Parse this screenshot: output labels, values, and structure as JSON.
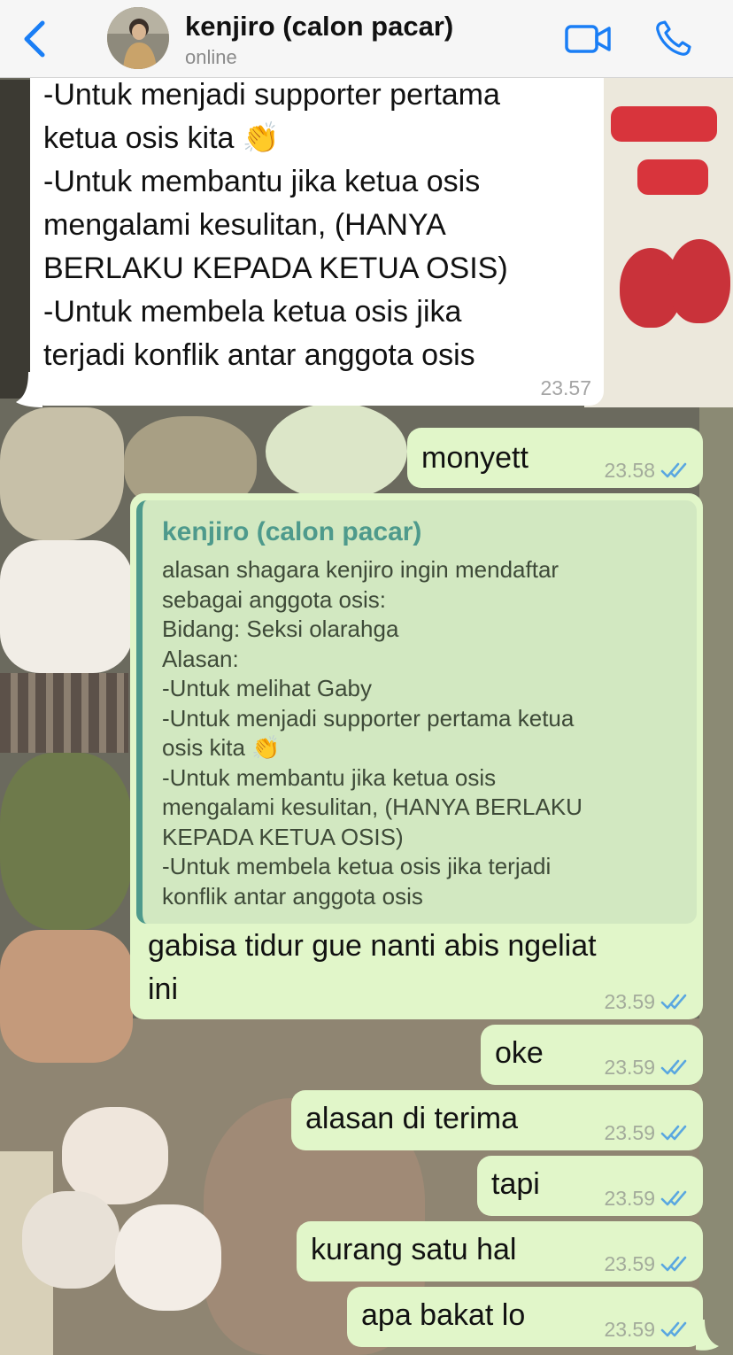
{
  "header": {
    "back_icon": "chevron-left-icon",
    "contact_name": "kenjiro (calon pacar)",
    "status": "online",
    "video_icon": "video-camera-icon",
    "call_icon": "phone-icon",
    "accent_color": "#1a7ef5"
  },
  "messages": [
    {
      "direction": "incoming",
      "text": "-Untuk menjadi supporter pertama\nketua osis kita 👏\n-Untuk membantu jika ketua osis\nmengalami kesulitan, (HANYA\nBERLAKU KEPADA KETUA OSIS)\n-Untuk membela ketua osis jika\nterjadi konflik antar anggota osis",
      "time": "23.57"
    },
    {
      "direction": "outgoing",
      "text": "monyett",
      "time": "23.58",
      "status_icon": "double-check-icon"
    },
    {
      "direction": "outgoing",
      "quote": {
        "author": "kenjiro (calon pacar)",
        "text": "alasan shagara kenjiro ingin mendaftar\nsebagai anggota osis:\nBidang: Seksi olarahga\nAlasan:\n-Untuk melihat Gaby\n-Untuk menjadi supporter pertama ketua\nosis kita 👏\n-Untuk membantu jika ketua osis\nmengalami kesulitan, (HANYA BERLAKU\nKEPADA KETUA OSIS)\n-Untuk membela ketua osis jika terjadi\nkonflik antar anggota osis"
      },
      "text": "gabisa tidur gue nanti abis ngeliat\nini",
      "time": "23.59",
      "status_icon": "double-check-icon"
    },
    {
      "direction": "outgoing",
      "text": "oke",
      "time": "23.59",
      "status_icon": "double-check-icon"
    },
    {
      "direction": "outgoing",
      "text": "alasan di terima",
      "time": "23.59",
      "status_icon": "double-check-icon"
    },
    {
      "direction": "outgoing",
      "text": "tapi",
      "time": "23.59",
      "status_icon": "double-check-icon"
    },
    {
      "direction": "outgoing",
      "text": "kurang satu hal",
      "time": "23.59",
      "status_icon": "double-check-icon"
    },
    {
      "direction": "outgoing",
      "text": "apa bakat lo",
      "time": "23.59",
      "status_icon": "double-check-icon"
    }
  ],
  "colors": {
    "outgoing_bubble": "#e1f6c9",
    "incoming_bubble": "#ffffff",
    "quote_accent": "#4e9a8c",
    "read_ticks": "#5aa7e0"
  }
}
